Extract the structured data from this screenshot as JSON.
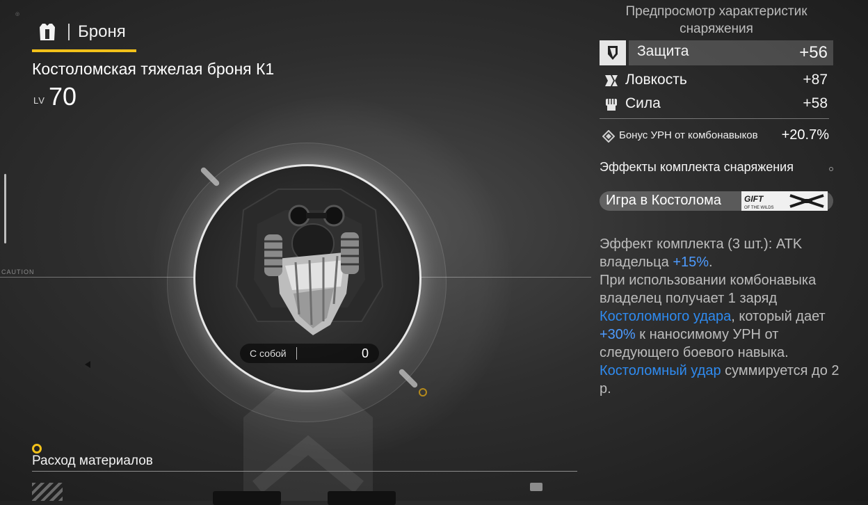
{
  "header": {
    "category_label": "Броня",
    "item_name": "Костоломская тяжелая броня К1",
    "level_label": "LV",
    "level_value": "70"
  },
  "preview": {
    "carry_label": "С собой",
    "carry_value": "0",
    "caution_label": "CAUTION"
  },
  "materials": {
    "title": "Расход материалов"
  },
  "stats_panel": {
    "title": "Предпросмотр характеристик снаряжения",
    "stats": [
      {
        "label": "Защита",
        "value": "+56",
        "icon": "shield-icon"
      },
      {
        "label": "Ловкость",
        "value": "+87",
        "icon": "agility-icon"
      },
      {
        "label": "Сила",
        "value": "+58",
        "icon": "fist-icon"
      }
    ],
    "bonus": {
      "label": "Бонус УРН от комбонавыков",
      "value": "+20.7%",
      "icon": "diamond-icon"
    }
  },
  "set_effects": {
    "title": "Эффекты комплекта снаряжения",
    "set_name": "Игра в Костолома",
    "logo_text": "GIFT",
    "logo_subtext": "OF THE WILDS",
    "effect": {
      "p1": "Эффект комплекта (3 шт.): ATK владельца ",
      "p1_hl": "+15%",
      "p1_end": ".",
      "p2": "При использовании комбонавыка владелец получает 1 заряд ",
      "p2_hl": "Костоломного удара",
      "p3": ", который дает ",
      "p3_hl": "+30%",
      "p4": " к наносимому УРН от следующего боевого навыка. ",
      "p4_hl": "Костоломный удар",
      "p5": " суммируется до 2 р."
    }
  },
  "colors": {
    "accent": "#f2c11a",
    "highlight": "#4d9bff"
  }
}
